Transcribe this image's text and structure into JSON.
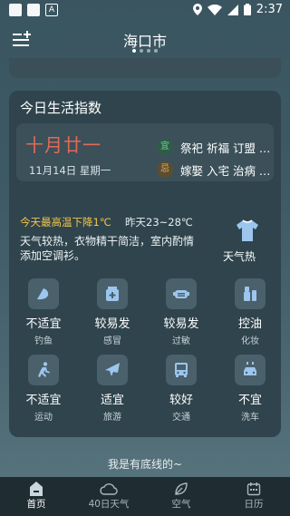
{
  "status": {
    "time": "2:37"
  },
  "header": {
    "city": "海口市"
  },
  "card": {
    "title": "今日生活指数",
    "lunar_date": "十月廿一",
    "solar_date": "11月14日 星期一",
    "yi_badge": "宜",
    "ji_badge": "忌",
    "yi_text": "祭祀 祈福 订盟 …",
    "ji_text": "嫁娶 入宅 治病 …",
    "temp_warning": "今天最高温下降1℃",
    "temp_range": "昨天23~28℃",
    "description": "天气较热，衣物精干简洁，室内酌情添加空调衫。",
    "clothing_label": "天气热",
    "indices": [
      {
        "icon": "fishing-icon",
        "value": "不适宜",
        "label": "钓鱼"
      },
      {
        "icon": "cold-medicine-icon",
        "value": "较易发",
        "label": "感冒"
      },
      {
        "icon": "allergy-mask-icon",
        "value": "较易发",
        "label": "过敏"
      },
      {
        "icon": "cosmetics-icon",
        "value": "控油",
        "label": "化妆"
      },
      {
        "icon": "running-icon",
        "value": "不适宜",
        "label": "运动"
      },
      {
        "icon": "airplane-icon",
        "value": "适宜",
        "label": "旅游"
      },
      {
        "icon": "bus-icon",
        "value": "较好",
        "label": "交通"
      },
      {
        "icon": "car-wash-icon",
        "value": "不宜",
        "label": "洗车"
      }
    ]
  },
  "footer_note": "我是有底线的~",
  "nav": [
    {
      "label": "首页",
      "icon": "home-icon",
      "active": true
    },
    {
      "label": "40日天气",
      "icon": "cloud-icon",
      "active": false
    },
    {
      "label": "空气",
      "icon": "leaf-icon",
      "active": false
    },
    {
      "label": "日历",
      "icon": "calendar-icon",
      "active": false
    }
  ],
  "colors": {
    "lunar": "#e06a58",
    "warning": "#f1c64b",
    "yi": "#6cd39a",
    "ji": "#e0b060"
  }
}
